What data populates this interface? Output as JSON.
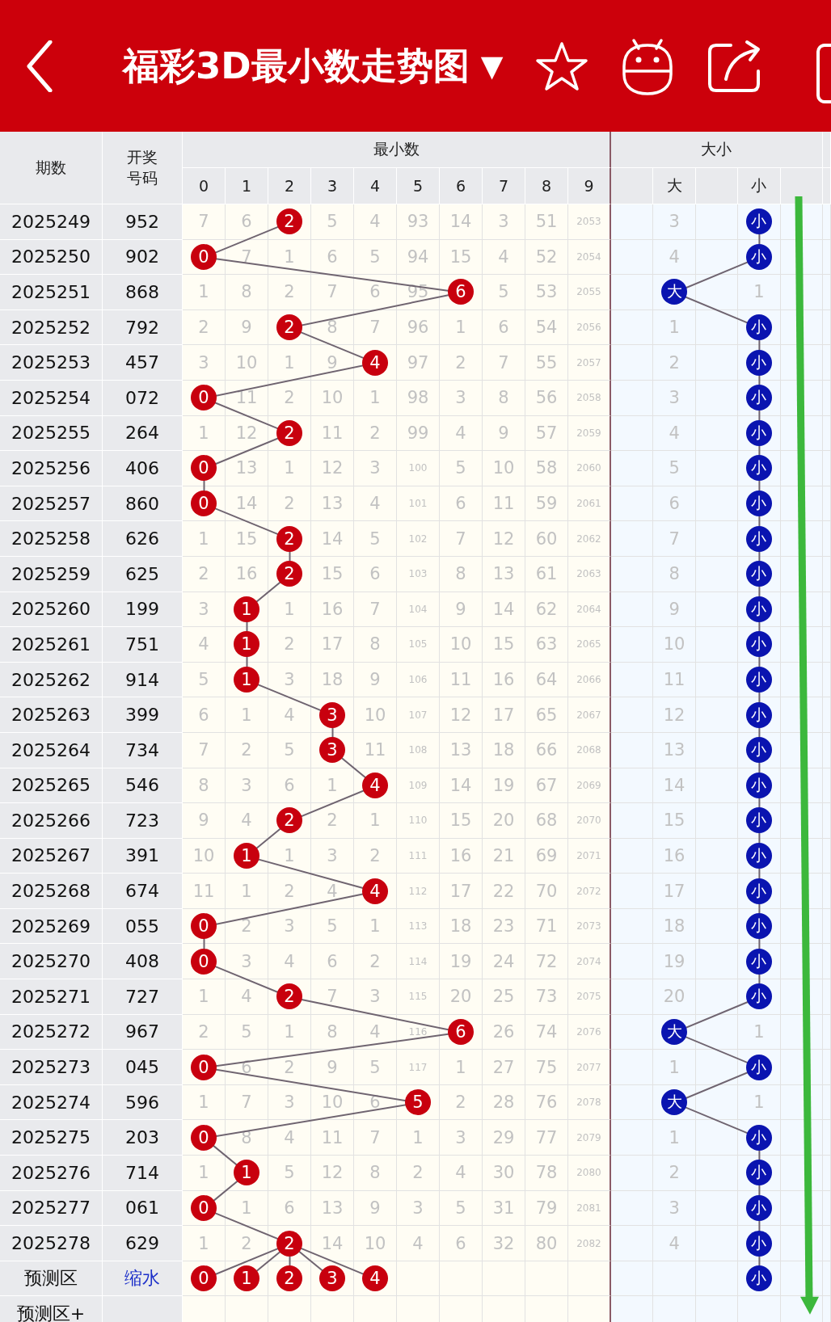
{
  "header": {
    "title": "福彩3D最小数走势图",
    "dropdown": "▼"
  },
  "columns": {
    "period": "期数",
    "number_lines": [
      "开奖",
      "号码"
    ],
    "digits_group": "最小数",
    "digits": [
      "0",
      "1",
      "2",
      "3",
      "4",
      "5",
      "6",
      "7",
      "8",
      "9"
    ],
    "size_group": "大小",
    "size_labels": [
      "大",
      "小"
    ]
  },
  "rows": [
    {
      "period": "2025249",
      "number": "952",
      "cells": [
        "7",
        "6",
        "2",
        "5",
        "4",
        "93",
        "14",
        "3",
        "51",
        "2053"
      ],
      "hits": [
        false,
        false,
        true,
        false,
        false,
        false,
        false,
        false,
        false,
        false
      ],
      "size": [
        {
          "text": "3",
          "hit": false
        },
        {
          "text": "小",
          "hit": true
        }
      ]
    },
    {
      "period": "2025250",
      "number": "902",
      "cells": [
        "0",
        "7",
        "1",
        "6",
        "5",
        "94",
        "15",
        "4",
        "52",
        "2054"
      ],
      "hits": [
        true,
        false,
        false,
        false,
        false,
        false,
        false,
        false,
        false,
        false
      ],
      "size": [
        {
          "text": "4",
          "hit": false
        },
        {
          "text": "小",
          "hit": true
        }
      ]
    },
    {
      "period": "2025251",
      "number": "868",
      "cells": [
        "1",
        "8",
        "2",
        "7",
        "6",
        "95",
        "6",
        "5",
        "53",
        "2055"
      ],
      "hits": [
        false,
        false,
        false,
        false,
        false,
        false,
        true,
        false,
        false,
        false
      ],
      "size": [
        {
          "text": "大",
          "hit": true
        },
        {
          "text": "1",
          "hit": false
        }
      ]
    },
    {
      "period": "2025252",
      "number": "792",
      "cells": [
        "2",
        "9",
        "2",
        "8",
        "7",
        "96",
        "1",
        "6",
        "54",
        "2056"
      ],
      "hits": [
        false,
        false,
        true,
        false,
        false,
        false,
        false,
        false,
        false,
        false
      ],
      "size": [
        {
          "text": "1",
          "hit": false
        },
        {
          "text": "小",
          "hit": true
        }
      ]
    },
    {
      "period": "2025253",
      "number": "457",
      "cells": [
        "3",
        "10",
        "1",
        "9",
        "4",
        "97",
        "2",
        "7",
        "55",
        "2057"
      ],
      "hits": [
        false,
        false,
        false,
        false,
        true,
        false,
        false,
        false,
        false,
        false
      ],
      "size": [
        {
          "text": "2",
          "hit": false
        },
        {
          "text": "小",
          "hit": true
        }
      ]
    },
    {
      "period": "2025254",
      "number": "072",
      "cells": [
        "0",
        "11",
        "2",
        "10",
        "1",
        "98",
        "3",
        "8",
        "56",
        "2058"
      ],
      "hits": [
        true,
        false,
        false,
        false,
        false,
        false,
        false,
        false,
        false,
        false
      ],
      "size": [
        {
          "text": "3",
          "hit": false
        },
        {
          "text": "小",
          "hit": true
        }
      ]
    },
    {
      "period": "2025255",
      "number": "264",
      "cells": [
        "1",
        "12",
        "2",
        "11",
        "2",
        "99",
        "4",
        "9",
        "57",
        "2059"
      ],
      "hits": [
        false,
        false,
        true,
        false,
        false,
        false,
        false,
        false,
        false,
        false
      ],
      "size": [
        {
          "text": "4",
          "hit": false
        },
        {
          "text": "小",
          "hit": true
        }
      ]
    },
    {
      "period": "2025256",
      "number": "406",
      "cells": [
        "0",
        "13",
        "1",
        "12",
        "3",
        "100",
        "5",
        "10",
        "58",
        "2060"
      ],
      "hits": [
        true,
        false,
        false,
        false,
        false,
        false,
        false,
        false,
        false,
        false
      ],
      "size": [
        {
          "text": "5",
          "hit": false
        },
        {
          "text": "小",
          "hit": true
        }
      ]
    },
    {
      "period": "2025257",
      "number": "860",
      "cells": [
        "0",
        "14",
        "2",
        "13",
        "4",
        "101",
        "6",
        "11",
        "59",
        "2061"
      ],
      "hits": [
        true,
        false,
        false,
        false,
        false,
        false,
        false,
        false,
        false,
        false
      ],
      "size": [
        {
          "text": "6",
          "hit": false
        },
        {
          "text": "小",
          "hit": true
        }
      ]
    },
    {
      "period": "2025258",
      "number": "626",
      "cells": [
        "1",
        "15",
        "2",
        "14",
        "5",
        "102",
        "7",
        "12",
        "60",
        "2062"
      ],
      "hits": [
        false,
        false,
        true,
        false,
        false,
        false,
        false,
        false,
        false,
        false
      ],
      "size": [
        {
          "text": "7",
          "hit": false
        },
        {
          "text": "小",
          "hit": true
        }
      ]
    },
    {
      "period": "2025259",
      "number": "625",
      "cells": [
        "2",
        "16",
        "2",
        "15",
        "6",
        "103",
        "8",
        "13",
        "61",
        "2063"
      ],
      "hits": [
        false,
        false,
        true,
        false,
        false,
        false,
        false,
        false,
        false,
        false
      ],
      "size": [
        {
          "text": "8",
          "hit": false
        },
        {
          "text": "小",
          "hit": true
        }
      ]
    },
    {
      "period": "2025260",
      "number": "199",
      "cells": [
        "3",
        "1",
        "1",
        "16",
        "7",
        "104",
        "9",
        "14",
        "62",
        "2064"
      ],
      "hits": [
        false,
        true,
        false,
        false,
        false,
        false,
        false,
        false,
        false,
        false
      ],
      "size": [
        {
          "text": "9",
          "hit": false
        },
        {
          "text": "小",
          "hit": true
        }
      ]
    },
    {
      "period": "2025261",
      "number": "751",
      "cells": [
        "4",
        "1",
        "2",
        "17",
        "8",
        "105",
        "10",
        "15",
        "63",
        "2065"
      ],
      "hits": [
        false,
        true,
        false,
        false,
        false,
        false,
        false,
        false,
        false,
        false
      ],
      "size": [
        {
          "text": "10",
          "hit": false
        },
        {
          "text": "小",
          "hit": true
        }
      ]
    },
    {
      "period": "2025262",
      "number": "914",
      "cells": [
        "5",
        "1",
        "3",
        "18",
        "9",
        "106",
        "11",
        "16",
        "64",
        "2066"
      ],
      "hits": [
        false,
        true,
        false,
        false,
        false,
        false,
        false,
        false,
        false,
        false
      ],
      "size": [
        {
          "text": "11",
          "hit": false
        },
        {
          "text": "小",
          "hit": true
        }
      ]
    },
    {
      "period": "2025263",
      "number": "399",
      "cells": [
        "6",
        "1",
        "4",
        "3",
        "10",
        "107",
        "12",
        "17",
        "65",
        "2067"
      ],
      "hits": [
        false,
        false,
        false,
        true,
        false,
        false,
        false,
        false,
        false,
        false
      ],
      "size": [
        {
          "text": "12",
          "hit": false
        },
        {
          "text": "小",
          "hit": true
        }
      ]
    },
    {
      "period": "2025264",
      "number": "734",
      "cells": [
        "7",
        "2",
        "5",
        "3",
        "11",
        "108",
        "13",
        "18",
        "66",
        "2068"
      ],
      "hits": [
        false,
        false,
        false,
        true,
        false,
        false,
        false,
        false,
        false,
        false
      ],
      "size": [
        {
          "text": "13",
          "hit": false
        },
        {
          "text": "小",
          "hit": true
        }
      ]
    },
    {
      "period": "2025265",
      "number": "546",
      "cells": [
        "8",
        "3",
        "6",
        "1",
        "4",
        "109",
        "14",
        "19",
        "67",
        "2069"
      ],
      "hits": [
        false,
        false,
        false,
        false,
        true,
        false,
        false,
        false,
        false,
        false
      ],
      "size": [
        {
          "text": "14",
          "hit": false
        },
        {
          "text": "小",
          "hit": true
        }
      ]
    },
    {
      "period": "2025266",
      "number": "723",
      "cells": [
        "9",
        "4",
        "2",
        "2",
        "1",
        "110",
        "15",
        "20",
        "68",
        "2070"
      ],
      "hits": [
        false,
        false,
        true,
        false,
        false,
        false,
        false,
        false,
        false,
        false
      ],
      "size": [
        {
          "text": "15",
          "hit": false
        },
        {
          "text": "小",
          "hit": true
        }
      ]
    },
    {
      "period": "2025267",
      "number": "391",
      "cells": [
        "10",
        "1",
        "1",
        "3",
        "2",
        "111",
        "16",
        "21",
        "69",
        "2071"
      ],
      "hits": [
        false,
        true,
        false,
        false,
        false,
        false,
        false,
        false,
        false,
        false
      ],
      "size": [
        {
          "text": "16",
          "hit": false
        },
        {
          "text": "小",
          "hit": true
        }
      ]
    },
    {
      "period": "2025268",
      "number": "674",
      "cells": [
        "11",
        "1",
        "2",
        "4",
        "4",
        "112",
        "17",
        "22",
        "70",
        "2072"
      ],
      "hits": [
        false,
        false,
        false,
        false,
        true,
        false,
        false,
        false,
        false,
        false
      ],
      "size": [
        {
          "text": "17",
          "hit": false
        },
        {
          "text": "小",
          "hit": true
        }
      ]
    },
    {
      "period": "2025269",
      "number": "055",
      "cells": [
        "0",
        "2",
        "3",
        "5",
        "1",
        "113",
        "18",
        "23",
        "71",
        "2073"
      ],
      "hits": [
        true,
        false,
        false,
        false,
        false,
        false,
        false,
        false,
        false,
        false
      ],
      "size": [
        {
          "text": "18",
          "hit": false
        },
        {
          "text": "小",
          "hit": true
        }
      ]
    },
    {
      "period": "2025270",
      "number": "408",
      "cells": [
        "0",
        "3",
        "4",
        "6",
        "2",
        "114",
        "19",
        "24",
        "72",
        "2074"
      ],
      "hits": [
        true,
        false,
        false,
        false,
        false,
        false,
        false,
        false,
        false,
        false
      ],
      "size": [
        {
          "text": "19",
          "hit": false
        },
        {
          "text": "小",
          "hit": true
        }
      ]
    },
    {
      "period": "2025271",
      "number": "727",
      "cells": [
        "1",
        "4",
        "2",
        "7",
        "3",
        "115",
        "20",
        "25",
        "73",
        "2075"
      ],
      "hits": [
        false,
        false,
        true,
        false,
        false,
        false,
        false,
        false,
        false,
        false
      ],
      "size": [
        {
          "text": "20",
          "hit": false
        },
        {
          "text": "小",
          "hit": true
        }
      ]
    },
    {
      "period": "2025272",
      "number": "967",
      "cells": [
        "2",
        "5",
        "1",
        "8",
        "4",
        "116",
        "6",
        "26",
        "74",
        "2076"
      ],
      "hits": [
        false,
        false,
        false,
        false,
        false,
        false,
        true,
        false,
        false,
        false
      ],
      "size": [
        {
          "text": "大",
          "hit": true
        },
        {
          "text": "1",
          "hit": false
        }
      ]
    },
    {
      "period": "2025273",
      "number": "045",
      "cells": [
        "0",
        "6",
        "2",
        "9",
        "5",
        "117",
        "1",
        "27",
        "75",
        "2077"
      ],
      "hits": [
        true,
        false,
        false,
        false,
        false,
        false,
        false,
        false,
        false,
        false
      ],
      "size": [
        {
          "text": "1",
          "hit": false
        },
        {
          "text": "小",
          "hit": true
        }
      ]
    },
    {
      "period": "2025274",
      "number": "596",
      "cells": [
        "1",
        "7",
        "3",
        "10",
        "6",
        "5",
        "2",
        "28",
        "76",
        "2078"
      ],
      "hits": [
        false,
        false,
        false,
        false,
        false,
        true,
        false,
        false,
        false,
        false
      ],
      "size": [
        {
          "text": "大",
          "hit": true
        },
        {
          "text": "1",
          "hit": false
        }
      ]
    },
    {
      "period": "2025275",
      "number": "203",
      "cells": [
        "0",
        "8",
        "4",
        "11",
        "7",
        "1",
        "3",
        "29",
        "77",
        "2079"
      ],
      "hits": [
        true,
        false,
        false,
        false,
        false,
        false,
        false,
        false,
        false,
        false
      ],
      "size": [
        {
          "text": "1",
          "hit": false
        },
        {
          "text": "小",
          "hit": true
        }
      ]
    },
    {
      "period": "2025276",
      "number": "714",
      "cells": [
        "1",
        "1",
        "5",
        "12",
        "8",
        "2",
        "4",
        "30",
        "78",
        "2080"
      ],
      "hits": [
        false,
        true,
        false,
        false,
        false,
        false,
        false,
        false,
        false,
        false
      ],
      "size": [
        {
          "text": "2",
          "hit": false
        },
        {
          "text": "小",
          "hit": true
        }
      ]
    },
    {
      "period": "2025277",
      "number": "061",
      "cells": [
        "0",
        "1",
        "6",
        "13",
        "9",
        "3",
        "5",
        "31",
        "79",
        "2081"
      ],
      "hits": [
        true,
        false,
        false,
        false,
        false,
        false,
        false,
        false,
        false,
        false
      ],
      "size": [
        {
          "text": "3",
          "hit": false
        },
        {
          "text": "小",
          "hit": true
        }
      ]
    },
    {
      "period": "2025278",
      "number": "629",
      "cells": [
        "1",
        "2",
        "2",
        "14",
        "10",
        "4",
        "6",
        "32",
        "80",
        "2082"
      ],
      "hits": [
        false,
        false,
        true,
        false,
        false,
        false,
        false,
        false,
        false,
        false
      ],
      "size": [
        {
          "text": "4",
          "hit": false
        },
        {
          "text": "小",
          "hit": true
        }
      ]
    }
  ],
  "prediction": {
    "label": "预测区",
    "filter": "缩水",
    "balls": [
      "0",
      "1",
      "2",
      "3",
      "4"
    ],
    "size_ball": "小"
  },
  "prediction_plus": {
    "label": "预测区+"
  }
}
